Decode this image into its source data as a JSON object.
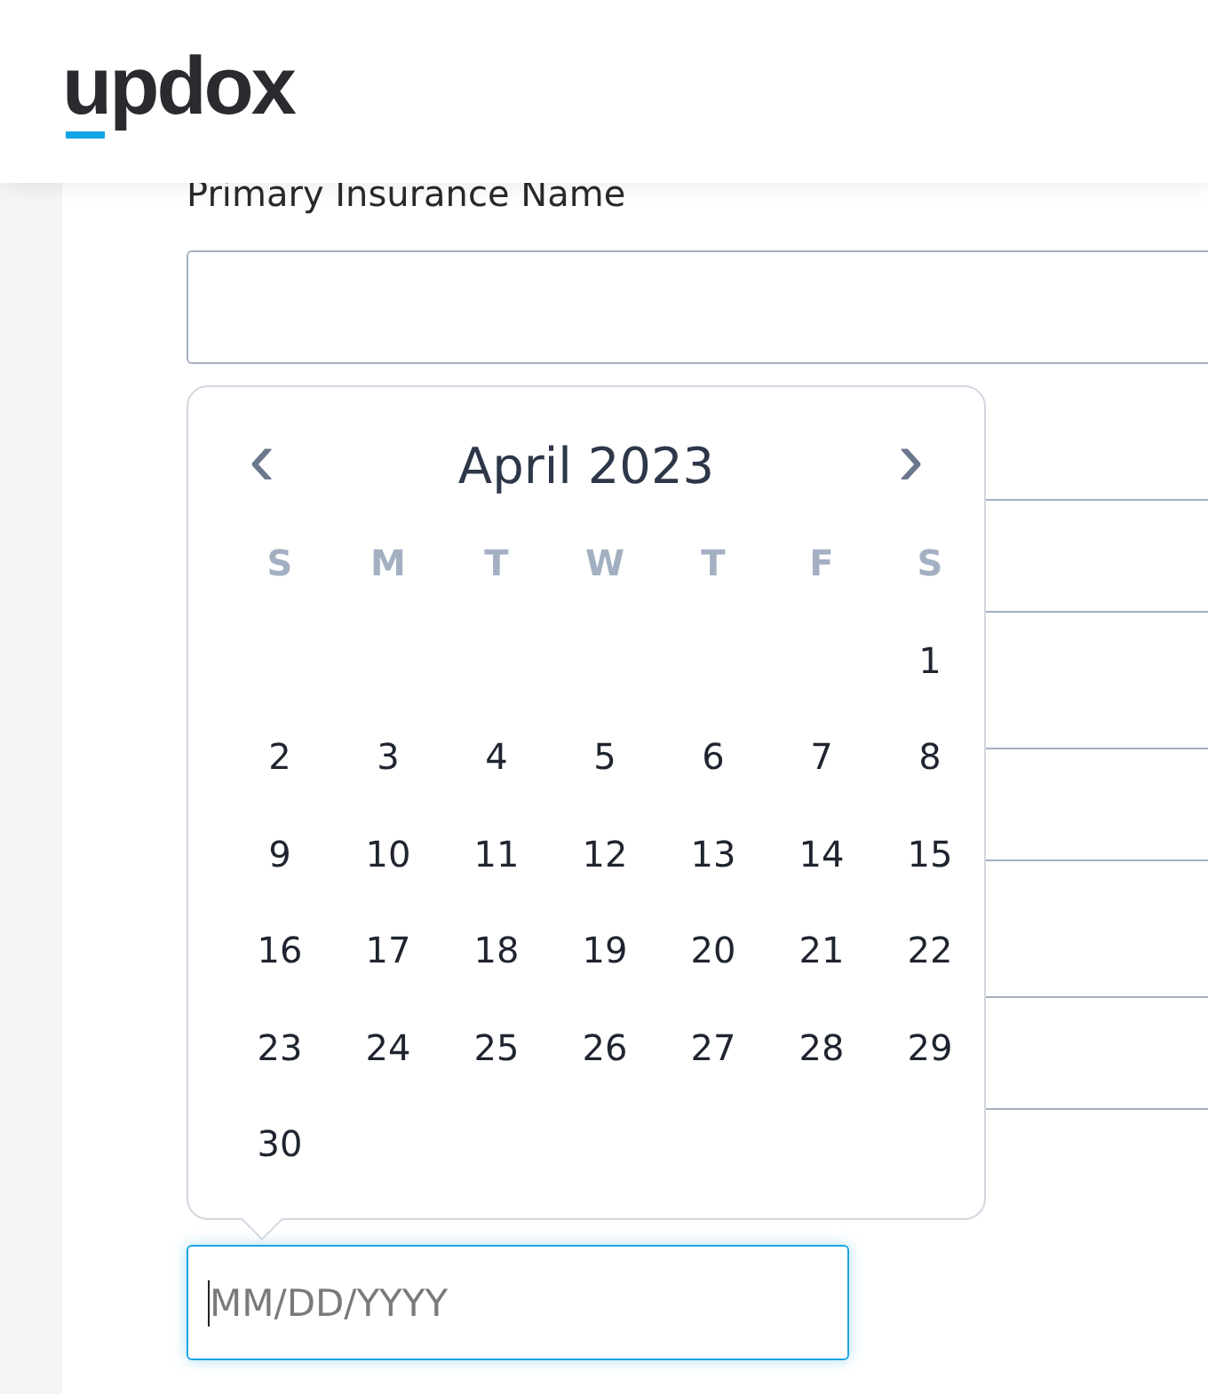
{
  "header": {
    "logo": "updox"
  },
  "fields": [
    {
      "kind": "text",
      "label": "Primary Insurance Name",
      "focused": false
    },
    {
      "kind": "text",
      "focused": false
    },
    {
      "kind": "text",
      "focused": false
    },
    {
      "kind": "text",
      "focused": false
    },
    {
      "kind": "date",
      "placeholder": "MM/DD/YYYY",
      "focused": true
    }
  ],
  "calendar": {
    "prev": "‹",
    "next": "›",
    "title": "April 2023",
    "weekdays": [
      "S",
      "M",
      "T",
      "W",
      "T",
      "F",
      "S"
    ],
    "weeks": [
      {
        "kind": "lead",
        "days": [
          "1"
        ]
      },
      {
        "kind": "full",
        "days": [
          "2",
          "3",
          "4",
          "5",
          "6",
          "7",
          "8"
        ]
      },
      {
        "kind": "full",
        "days": [
          "9",
          "10",
          "11",
          "12",
          "13",
          "14",
          "15"
        ]
      },
      {
        "kind": "full",
        "days": [
          "16",
          "17",
          "18",
          "19",
          "20",
          "21",
          "22"
        ]
      },
      {
        "kind": "full",
        "days": [
          "23",
          "24",
          "25",
          "26",
          "27",
          "28",
          "29"
        ]
      },
      {
        "kind": "tail",
        "days": [
          "30"
        ]
      }
    ]
  }
}
